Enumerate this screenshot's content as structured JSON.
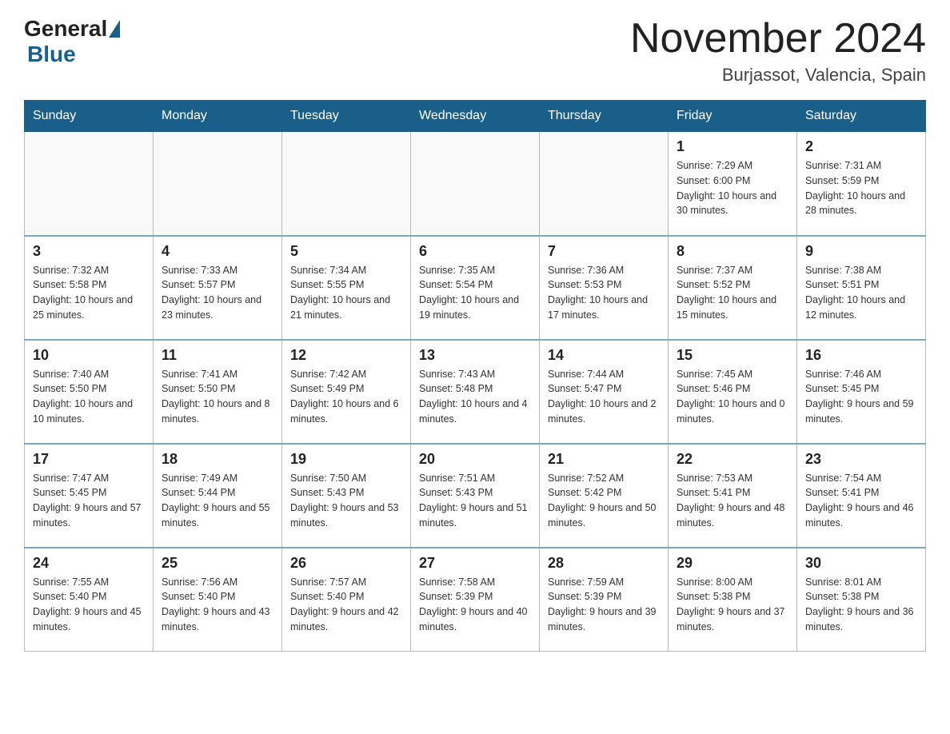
{
  "header": {
    "logo_general": "General",
    "logo_blue": "Blue",
    "month_title": "November 2024",
    "location": "Burjassot, Valencia, Spain"
  },
  "days_of_week": [
    "Sunday",
    "Monday",
    "Tuesday",
    "Wednesday",
    "Thursday",
    "Friday",
    "Saturday"
  ],
  "weeks": [
    [
      {
        "day": "",
        "sunrise": "",
        "sunset": "",
        "daylight": ""
      },
      {
        "day": "",
        "sunrise": "",
        "sunset": "",
        "daylight": ""
      },
      {
        "day": "",
        "sunrise": "",
        "sunset": "",
        "daylight": ""
      },
      {
        "day": "",
        "sunrise": "",
        "sunset": "",
        "daylight": ""
      },
      {
        "day": "",
        "sunrise": "",
        "sunset": "",
        "daylight": ""
      },
      {
        "day": "1",
        "sunrise": "Sunrise: 7:29 AM",
        "sunset": "Sunset: 6:00 PM",
        "daylight": "Daylight: 10 hours and 30 minutes."
      },
      {
        "day": "2",
        "sunrise": "Sunrise: 7:31 AM",
        "sunset": "Sunset: 5:59 PM",
        "daylight": "Daylight: 10 hours and 28 minutes."
      }
    ],
    [
      {
        "day": "3",
        "sunrise": "Sunrise: 7:32 AM",
        "sunset": "Sunset: 5:58 PM",
        "daylight": "Daylight: 10 hours and 25 minutes."
      },
      {
        "day": "4",
        "sunrise": "Sunrise: 7:33 AM",
        "sunset": "Sunset: 5:57 PM",
        "daylight": "Daylight: 10 hours and 23 minutes."
      },
      {
        "day": "5",
        "sunrise": "Sunrise: 7:34 AM",
        "sunset": "Sunset: 5:55 PM",
        "daylight": "Daylight: 10 hours and 21 minutes."
      },
      {
        "day": "6",
        "sunrise": "Sunrise: 7:35 AM",
        "sunset": "Sunset: 5:54 PM",
        "daylight": "Daylight: 10 hours and 19 minutes."
      },
      {
        "day": "7",
        "sunrise": "Sunrise: 7:36 AM",
        "sunset": "Sunset: 5:53 PM",
        "daylight": "Daylight: 10 hours and 17 minutes."
      },
      {
        "day": "8",
        "sunrise": "Sunrise: 7:37 AM",
        "sunset": "Sunset: 5:52 PM",
        "daylight": "Daylight: 10 hours and 15 minutes."
      },
      {
        "day": "9",
        "sunrise": "Sunrise: 7:38 AM",
        "sunset": "Sunset: 5:51 PM",
        "daylight": "Daylight: 10 hours and 12 minutes."
      }
    ],
    [
      {
        "day": "10",
        "sunrise": "Sunrise: 7:40 AM",
        "sunset": "Sunset: 5:50 PM",
        "daylight": "Daylight: 10 hours and 10 minutes."
      },
      {
        "day": "11",
        "sunrise": "Sunrise: 7:41 AM",
        "sunset": "Sunset: 5:50 PM",
        "daylight": "Daylight: 10 hours and 8 minutes."
      },
      {
        "day": "12",
        "sunrise": "Sunrise: 7:42 AM",
        "sunset": "Sunset: 5:49 PM",
        "daylight": "Daylight: 10 hours and 6 minutes."
      },
      {
        "day": "13",
        "sunrise": "Sunrise: 7:43 AM",
        "sunset": "Sunset: 5:48 PM",
        "daylight": "Daylight: 10 hours and 4 minutes."
      },
      {
        "day": "14",
        "sunrise": "Sunrise: 7:44 AM",
        "sunset": "Sunset: 5:47 PM",
        "daylight": "Daylight: 10 hours and 2 minutes."
      },
      {
        "day": "15",
        "sunrise": "Sunrise: 7:45 AM",
        "sunset": "Sunset: 5:46 PM",
        "daylight": "Daylight: 10 hours and 0 minutes."
      },
      {
        "day": "16",
        "sunrise": "Sunrise: 7:46 AM",
        "sunset": "Sunset: 5:45 PM",
        "daylight": "Daylight: 9 hours and 59 minutes."
      }
    ],
    [
      {
        "day": "17",
        "sunrise": "Sunrise: 7:47 AM",
        "sunset": "Sunset: 5:45 PM",
        "daylight": "Daylight: 9 hours and 57 minutes."
      },
      {
        "day": "18",
        "sunrise": "Sunrise: 7:49 AM",
        "sunset": "Sunset: 5:44 PM",
        "daylight": "Daylight: 9 hours and 55 minutes."
      },
      {
        "day": "19",
        "sunrise": "Sunrise: 7:50 AM",
        "sunset": "Sunset: 5:43 PM",
        "daylight": "Daylight: 9 hours and 53 minutes."
      },
      {
        "day": "20",
        "sunrise": "Sunrise: 7:51 AM",
        "sunset": "Sunset: 5:43 PM",
        "daylight": "Daylight: 9 hours and 51 minutes."
      },
      {
        "day": "21",
        "sunrise": "Sunrise: 7:52 AM",
        "sunset": "Sunset: 5:42 PM",
        "daylight": "Daylight: 9 hours and 50 minutes."
      },
      {
        "day": "22",
        "sunrise": "Sunrise: 7:53 AM",
        "sunset": "Sunset: 5:41 PM",
        "daylight": "Daylight: 9 hours and 48 minutes."
      },
      {
        "day": "23",
        "sunrise": "Sunrise: 7:54 AM",
        "sunset": "Sunset: 5:41 PM",
        "daylight": "Daylight: 9 hours and 46 minutes."
      }
    ],
    [
      {
        "day": "24",
        "sunrise": "Sunrise: 7:55 AM",
        "sunset": "Sunset: 5:40 PM",
        "daylight": "Daylight: 9 hours and 45 minutes."
      },
      {
        "day": "25",
        "sunrise": "Sunrise: 7:56 AM",
        "sunset": "Sunset: 5:40 PM",
        "daylight": "Daylight: 9 hours and 43 minutes."
      },
      {
        "day": "26",
        "sunrise": "Sunrise: 7:57 AM",
        "sunset": "Sunset: 5:40 PM",
        "daylight": "Daylight: 9 hours and 42 minutes."
      },
      {
        "day": "27",
        "sunrise": "Sunrise: 7:58 AM",
        "sunset": "Sunset: 5:39 PM",
        "daylight": "Daylight: 9 hours and 40 minutes."
      },
      {
        "day": "28",
        "sunrise": "Sunrise: 7:59 AM",
        "sunset": "Sunset: 5:39 PM",
        "daylight": "Daylight: 9 hours and 39 minutes."
      },
      {
        "day": "29",
        "sunrise": "Sunrise: 8:00 AM",
        "sunset": "Sunset: 5:38 PM",
        "daylight": "Daylight: 9 hours and 37 minutes."
      },
      {
        "day": "30",
        "sunrise": "Sunrise: 8:01 AM",
        "sunset": "Sunset: 5:38 PM",
        "daylight": "Daylight: 9 hours and 36 minutes."
      }
    ]
  ]
}
